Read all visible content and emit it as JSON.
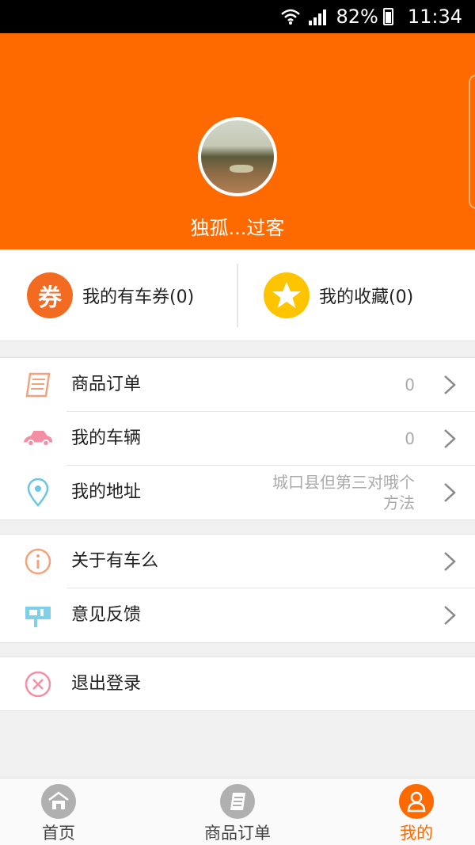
{
  "status_bar": {
    "battery": "82%",
    "time": "11:34"
  },
  "profile": {
    "username": "独孤...过客"
  },
  "quick": {
    "coupon_badge": "券",
    "coupon_label": "我的有车券(0)",
    "favorites_label": "我的收藏(0)"
  },
  "menu": {
    "orders": {
      "label": "商品订单",
      "value": "0"
    },
    "vehicles": {
      "label": "我的车辆",
      "value": "0"
    },
    "address": {
      "label": "我的地址",
      "value_line1": "城口县但第三对哦个",
      "value_line2": "方法"
    },
    "about": {
      "label": "关于有车么"
    },
    "feedback": {
      "label": "意见反馈"
    },
    "logout": {
      "label": "退出登录"
    }
  },
  "tabs": [
    {
      "label": "首页",
      "icon": "home-icon"
    },
    {
      "label": "商品订单",
      "icon": "orders-icon"
    },
    {
      "label": "我的",
      "icon": "user-icon",
      "active": true
    }
  ],
  "colors": {
    "accent": "#ff6a00",
    "coupon": "#f26b21",
    "star": "#ffc400"
  }
}
